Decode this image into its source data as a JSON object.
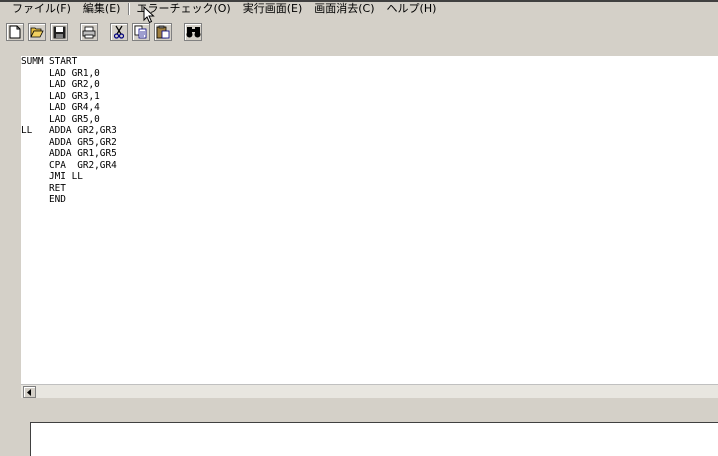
{
  "menubar": {
    "items": [
      "ファイル(F)",
      "編集(E)",
      "エラーチェック(O)",
      "実行画面(E)",
      "画面消去(C)",
      "ヘルプ(H)"
    ]
  },
  "toolbar": {
    "buttons": [
      "new-file-icon",
      "open-folder-icon",
      "save-icon",
      "print-icon",
      "cut-icon",
      "copy-icon",
      "paste-icon",
      "find-icon"
    ]
  },
  "editor": {
    "lines": [
      {
        "label": "SUMM",
        "code": "START"
      },
      {
        "label": "",
        "code": "LAD GR1,0"
      },
      {
        "label": "",
        "code": "LAD GR2,0"
      },
      {
        "label": "",
        "code": "LAD GR3,1"
      },
      {
        "label": "",
        "code": "LAD GR4,4"
      },
      {
        "label": "",
        "code": "LAD GR5,0"
      },
      {
        "label": "LL",
        "code": "ADDA GR2,GR3"
      },
      {
        "label": "",
        "code": "ADDA GR5,GR2"
      },
      {
        "label": "",
        "code": "ADDA GR1,GR5"
      },
      {
        "label": "",
        "code": "CPA  GR2,GR4"
      },
      {
        "label": "",
        "code": "JMI LL"
      },
      {
        "label": "",
        "code": "RET"
      },
      {
        "label": "",
        "code": "END"
      }
    ]
  },
  "colors": {
    "chrome": "#d4d0c8",
    "editor_bg": "#ffffff"
  }
}
